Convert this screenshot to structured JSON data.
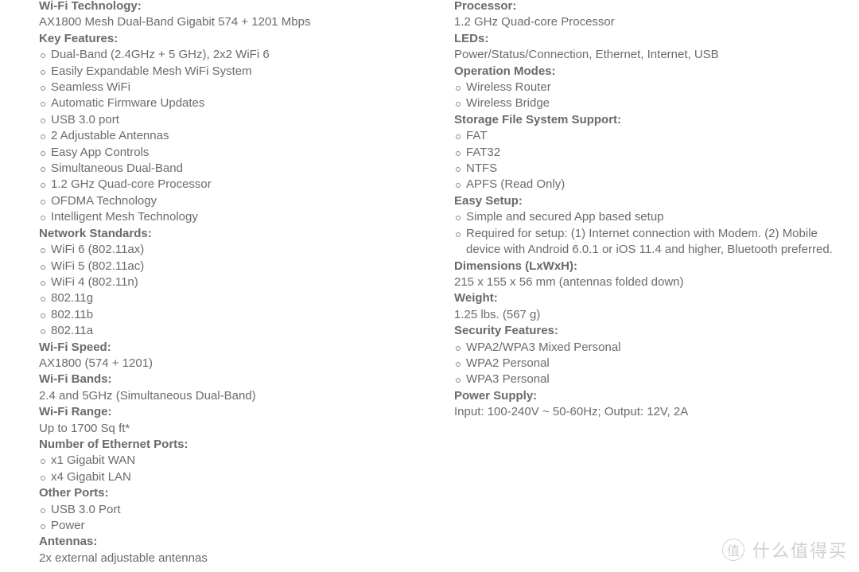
{
  "left": [
    {
      "heading": "Wi-Fi Technology:",
      "value": "AX1800 Mesh Dual-Band Gigabit 574 + 1201 Mbps"
    },
    {
      "heading": "Key Features:",
      "items": [
        "Dual-Band (2.4GHz + 5 GHz), 2x2 WiFi 6",
        "Easily Expandable Mesh WiFi System",
        "Seamless WiFi",
        "Automatic Firmware Updates",
        "USB 3.0 port",
        "2 Adjustable Antennas",
        "Easy App Controls",
        "Simultaneous Dual-Band",
        "1.2 GHz Quad-core Processor",
        "OFDMA Technology",
        "Intelligent Mesh Technology"
      ]
    },
    {
      "heading": "Network Standards:",
      "items": [
        "WiFi 6 (802.11ax)",
        "WiFi 5 (802.11ac)",
        "WiFi 4 (802.11n)",
        "802.11g",
        "802.11b",
        "802.11a"
      ]
    },
    {
      "heading": "Wi-Fi Speed:",
      "value": "AX1800 (574 + 1201)"
    },
    {
      "heading": "Wi-Fi Bands:",
      "value": "2.4 and 5GHz (Simultaneous Dual-Band)"
    },
    {
      "heading": "Wi-Fi Range:",
      "value": "Up to 1700 Sq ft*"
    },
    {
      "heading": "Number of Ethernet Ports:",
      "items": [
        "x1 Gigabit WAN",
        "x4 Gigabit LAN"
      ]
    },
    {
      "heading": "Other Ports:",
      "items": [
        "USB 3.0 Port",
        "Power"
      ]
    },
    {
      "heading": "Antennas:",
      "value": "2x external adjustable antennas"
    }
  ],
  "right": [
    {
      "heading": "Processor:",
      "value": "1.2 GHz Quad-core Processor"
    },
    {
      "heading": "LEDs:",
      "value": "Power/Status/Connection, Ethernet, Internet, USB"
    },
    {
      "heading": "Operation Modes:",
      "items": [
        "Wireless Router",
        "Wireless Bridge"
      ]
    },
    {
      "heading": "Storage File System Support:",
      "items": [
        "FAT",
        "FAT32",
        "NTFS",
        "APFS (Read Only)"
      ]
    },
    {
      "heading": "Easy Setup:",
      "items": [
        "Simple and secured App based setup",
        "Required for setup: (1) Internet connection with Modem. (2) Mobile device with Android 6.0.1 or iOS 11.4 and higher, Bluetooth preferred."
      ]
    },
    {
      "heading": "Dimensions (LxWxH):",
      "value": "215 x 155 x 56 mm (antennas folded down)"
    },
    {
      "heading": "Weight:",
      "value": "1.25 lbs. (567 g)"
    },
    {
      "heading": "Security Features:",
      "items": [
        "WPA2/WPA3 Mixed Personal",
        "WPA2 Personal",
        "WPA3 Personal"
      ]
    },
    {
      "heading": "Power Supply:",
      "value": "Input: 100-240V ~ 50-60Hz; Output: 12V, 2A"
    }
  ],
  "watermark": {
    "badge": "值",
    "text": "什么值得买"
  }
}
